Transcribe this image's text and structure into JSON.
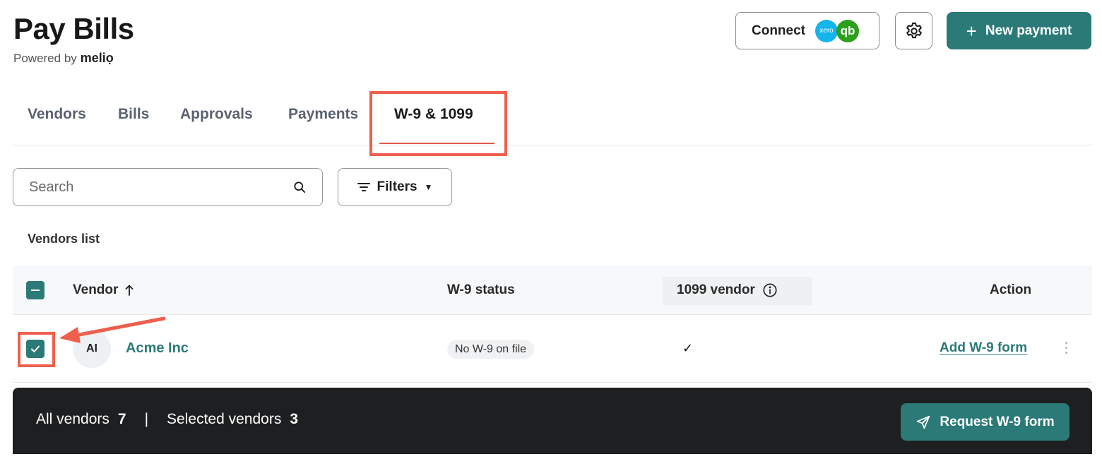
{
  "header": {
    "title": "Pay Bills",
    "powered_by": "Powered by",
    "brand": "meliọ",
    "connect_label": "Connect",
    "xero_text": "xero",
    "qb_text": "qb",
    "new_payment_label": "New payment",
    "plus_glyph": "+",
    "accent_color": "#2b7a78",
    "highlight_color": "#ee5f4d"
  },
  "tabs": [
    {
      "label": "Vendors",
      "active": false
    },
    {
      "label": "Bills",
      "active": false
    },
    {
      "label": "Approvals",
      "active": false
    },
    {
      "label": "Payments",
      "active": false
    },
    {
      "label": "W-9 & 1099",
      "active": true
    }
  ],
  "search": {
    "placeholder": "Search"
  },
  "filters": {
    "label": "Filters"
  },
  "list_title": "Vendors list",
  "table": {
    "columns": {
      "vendor": "Vendor",
      "w9_status": "W-9 status",
      "vendor_1099": "1099 vendor",
      "action": "Action"
    },
    "rows": [
      {
        "selected": true,
        "initials": "AI",
        "name": "Acme Inc",
        "w9_status": "No W-9 on file",
        "is_1099": "✓",
        "action": "Add W-9 form"
      }
    ]
  },
  "bottom_bar": {
    "all_label": "All vendors",
    "all_count": "7",
    "separator": "|",
    "selected_label": "Selected vendors",
    "selected_count": "3",
    "request_label": "Request W-9 form"
  }
}
